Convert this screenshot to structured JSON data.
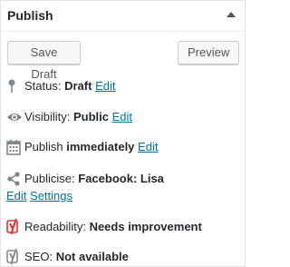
{
  "panel": {
    "title": "Publish",
    "toggle_icon": "arrow-up-icon"
  },
  "buttons": {
    "save_draft": "Save Draft",
    "preview": "Preview"
  },
  "status": {
    "label": "Status:",
    "value": "Draft",
    "edit": "Edit",
    "icon": "pin-icon"
  },
  "visibility": {
    "label": "Visibility:",
    "value": "Public",
    "edit": "Edit",
    "icon": "eye-icon"
  },
  "publish_time": {
    "label": "Publish",
    "value": "immediately",
    "edit": "Edit",
    "icon": "calendar-icon"
  },
  "publicise": {
    "label": "Publicise:",
    "value": "Facebook: Lisa",
    "edit": "Edit",
    "settings": "Settings",
    "icon": "share-icon"
  },
  "readability": {
    "label": "Readability:",
    "value": "Needs improvement",
    "icon": "yoast-icon",
    "color": "#dc3232"
  },
  "seo": {
    "label": "SEO:",
    "value": "Not available",
    "icon": "yoast-icon",
    "color": "#888888"
  },
  "colors": {
    "link": "#0073aa",
    "text": "#23282d",
    "icon": "#82878c"
  }
}
